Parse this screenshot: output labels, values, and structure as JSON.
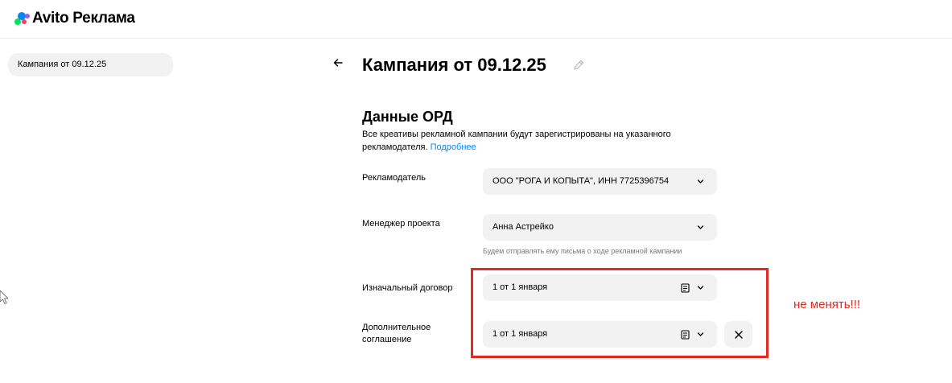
{
  "brand": {
    "name": "Avito Реклама",
    "colors": {
      "dot_green": "#04e061",
      "dot_blue": "#965eeb",
      "dot_red": "#ff4053",
      "dot_purple": "#0a86f0"
    }
  },
  "sidebar": {
    "items": [
      {
        "label": "Кампания от 09.12.25"
      }
    ]
  },
  "header": {
    "back_icon": "arrow-left-icon",
    "title": "Кампания от 09.12.25",
    "edit_icon": "pencil-icon"
  },
  "ord": {
    "title": "Данные ОРД",
    "description": "Все креативы рекламной кампании будут зарегистрированы на указанного рекламодателя.",
    "more_link": "Подробнее",
    "fields": {
      "advertiser": {
        "label": "Рекламодатель",
        "value": "ООО \"РОГА И КОПЫТА\", ИНН 7725396754"
      },
      "manager": {
        "label": "Менеджер проекта",
        "value": "Анна Астрейко",
        "hint": "Будем отправлять ему письма о ходе рекламной кампании"
      },
      "initial_contract": {
        "label": "Изначальный договор",
        "value": "1 от 1 января"
      },
      "additional_agreement": {
        "label": "Дополнительное соглашение",
        "value": "1 от 1 января"
      }
    }
  },
  "annotation": {
    "text": "не менять!!!",
    "color": "#e32a22"
  },
  "accent_link_color": "#0a86f0"
}
